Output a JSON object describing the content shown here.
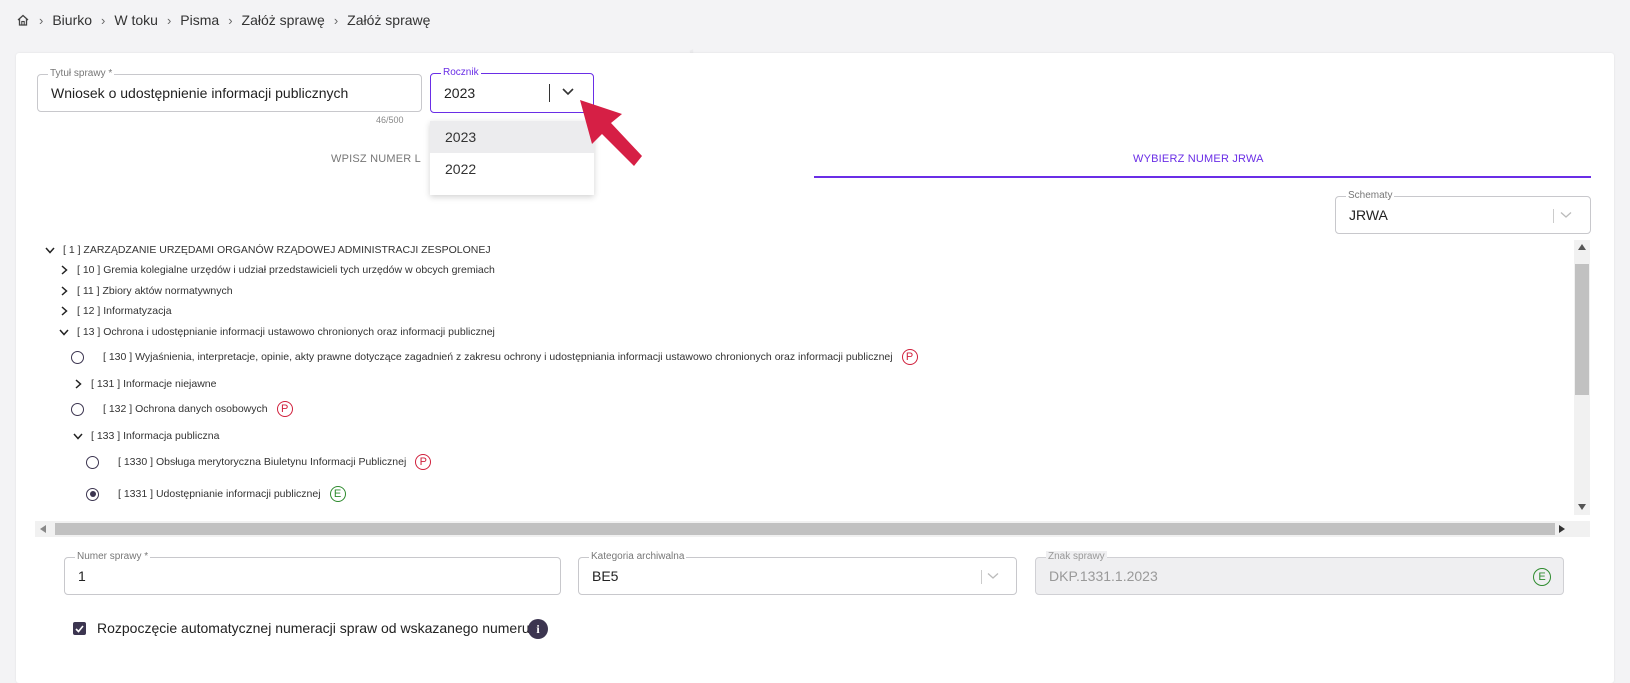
{
  "breadcrumb": {
    "home_icon": "home-icon",
    "items": [
      "Biurko",
      "W toku",
      "Pisma",
      "Załóż sprawę",
      "Załóż sprawę"
    ]
  },
  "title_field": {
    "label": "Tytuł sprawy *",
    "value": "Wniosek o udostępnienie informacji publicznych",
    "counter": "46/500"
  },
  "year_field": {
    "label": "Rocznik",
    "value": "2023",
    "options": [
      "2023",
      "2022"
    ]
  },
  "tabs": {
    "enter_number": "WPISZ NUMER L",
    "choose_jrwa": "WYBIERZ NUMER JRWA",
    "active_color": "#6a2ee6"
  },
  "schemes_field": {
    "label": "Schematy",
    "value": "JRWA"
  },
  "tree": [
    {
      "text": "[ 1 ] ZARZĄDZANIE URZĘDAMI ORGANÓW RZĄDOWEJ ADMINISTRACJI ZESPOLONEJ"
    },
    {
      "text": "[ 10 ] Gremia kolegialne urzędów i udział przedstawicieli tych urzędów w obcych gremiach"
    },
    {
      "text": "[ 11 ] Zbiory aktów normatywnych"
    },
    {
      "text": "[ 12 ] Informatyzacja"
    },
    {
      "text": "[ 13 ] Ochrona i udostępnianie informacji ustawowo chronionych oraz informacji publicznej"
    },
    {
      "text": "[ 130 ] Wyjaśnienia, interpretacje, opinie, akty prawne dotyczące zagadnień z zakresu ochrony i udostępniania informacji ustawowo chronionych oraz informacji publicznej",
      "badge": "P"
    },
    {
      "text": "[ 131 ] Informacje niejawne"
    },
    {
      "text": "[ 132 ] Ochrona danych osobowych",
      "badge": "P"
    },
    {
      "text": "[ 133 ] Informacja publiczna"
    },
    {
      "text": "[ 1330 ] Obsługa merytoryczna Biuletynu Informacji Publicznej",
      "badge": "P"
    },
    {
      "text": "[ 1331 ] Udostępnianie informacji publicznej",
      "badge": "E"
    }
  ],
  "case_number_field": {
    "label": "Numer sprawy *",
    "value": "1"
  },
  "archive_category_field": {
    "label": "Kategoria archiwalna",
    "value": "BE5"
  },
  "case_sign_field": {
    "label": "Znak sprawy",
    "value": "DKP.1331.1.2023",
    "badge": "E"
  },
  "auto_numbering": {
    "label": "Rozpoczęcie automatycznej numeracji spraw od wskazanego numeru",
    "checked": true,
    "info_icon": "info-icon"
  },
  "colors": {
    "accent": "#6a2ee6",
    "badge_p": "#d0203c",
    "badge_e": "#2e8b2e",
    "arrow": "#d61f45"
  }
}
